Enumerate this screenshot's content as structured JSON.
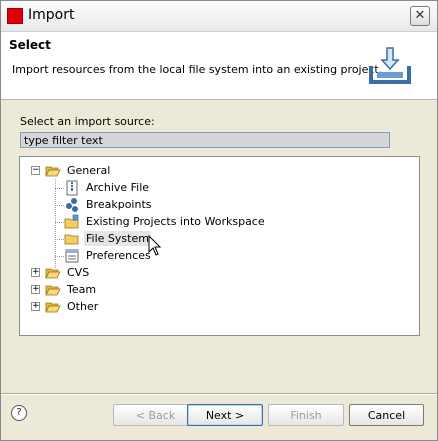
{
  "window": {
    "title": "Import",
    "close_glyph": "✕"
  },
  "banner": {
    "title": "Select",
    "description": "Import resources from the local file system into an existing project.",
    "icon": "import-wizard-icon"
  },
  "source": {
    "label": "Select an import source:",
    "filter_placeholder": "type filter text"
  },
  "tree": {
    "general": {
      "label": "General",
      "expanded": true,
      "twisty": "−"
    },
    "children": {
      "archive": {
        "label": "Archive File",
        "icon": "archive-file-icon"
      },
      "breakpoints": {
        "label": "Breakpoints",
        "icon": "breakpoints-icon"
      },
      "existing": {
        "label": "Existing Projects into Workspace",
        "icon": "existing-project-icon"
      },
      "filesystem": {
        "label": "File System",
        "icon": "folder-icon",
        "hovered": true
      },
      "preferences": {
        "label": "Preferences",
        "icon": "preferences-icon"
      }
    },
    "cvs": {
      "label": "CVS",
      "twisty": "+"
    },
    "team": {
      "label": "Team",
      "twisty": "+"
    },
    "other": {
      "label": "Other",
      "twisty": "+"
    }
  },
  "buttons": {
    "help": "?",
    "back": "< Back",
    "next": "Next >",
    "finish": "Finish",
    "cancel": "Cancel"
  },
  "colors": {
    "title_icon": "#e00000",
    "folder": "#f0c94a"
  }
}
